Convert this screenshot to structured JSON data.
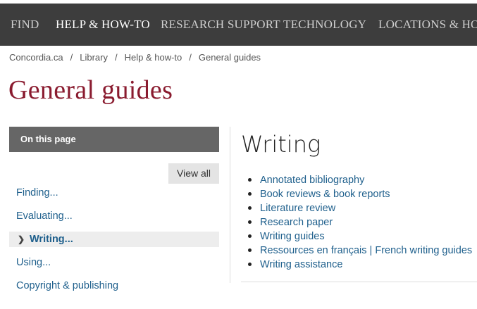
{
  "topnav": {
    "items": [
      {
        "label": "FIND"
      },
      {
        "label": "HELP & HOW-TO"
      },
      {
        "label": "RESEARCH SUPPORT"
      },
      {
        "label": "TECHNOLOGY"
      },
      {
        "label": "LOCATIONS & HOURS"
      }
    ],
    "active_index": 1
  },
  "breadcrumb": {
    "items": [
      "Concordia.ca",
      "Library",
      "Help & how-to",
      "General guides"
    ],
    "separator": "/"
  },
  "page_title": "General guides",
  "sidebar": {
    "header": "On this page",
    "view_all_label": "View all",
    "links": [
      "Finding...",
      "Evaluating...",
      "Writing...",
      "Using...",
      "Copyright & publishing"
    ],
    "current_index": 2
  },
  "content": {
    "title": "Writing",
    "links": [
      "Annotated bibliography",
      "Book reviews & book reports",
      "Literature review",
      "Research paper",
      "Writing guides",
      "Ressources en français | French writing guides",
      "Writing assistance"
    ]
  },
  "colors": {
    "nav_bg": "#3d3d3d",
    "title_maroon": "#8a1b2f",
    "link_blue": "#1e5f8c",
    "sidebar_header_bg": "#666666"
  }
}
